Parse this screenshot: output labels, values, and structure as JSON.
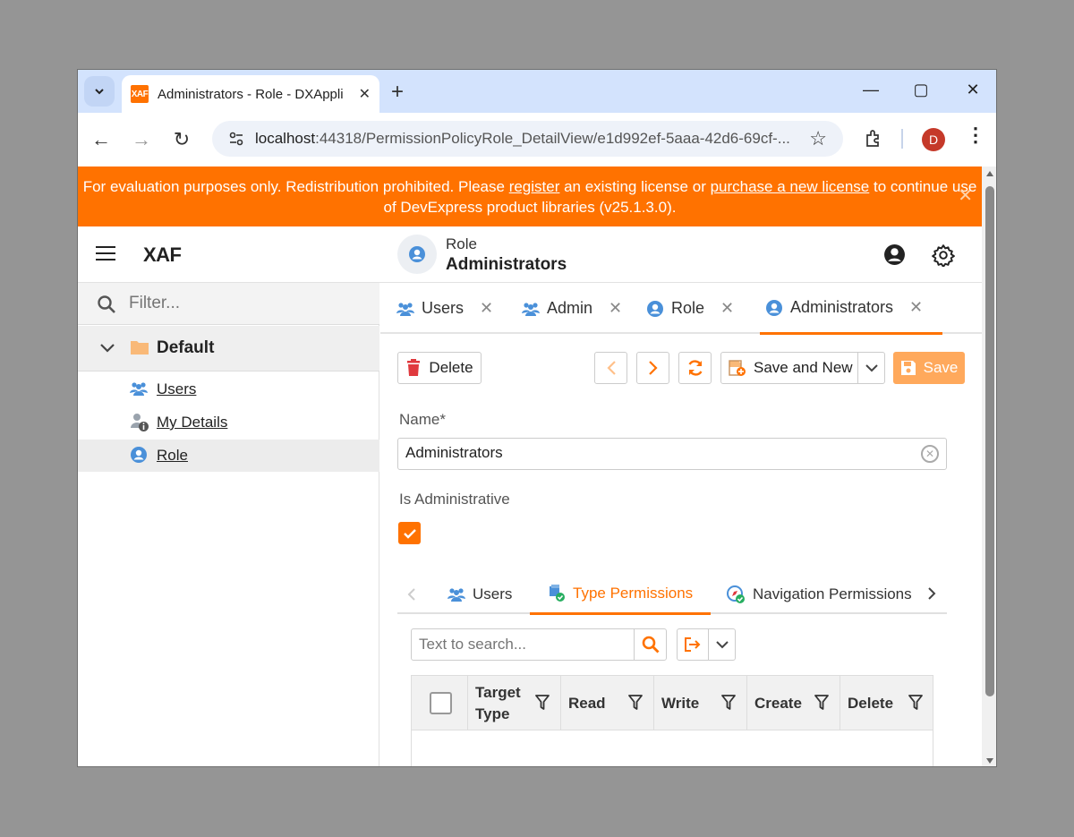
{
  "browser": {
    "tab_title": "Administrators - Role - DXAppli",
    "favicon_text": "XAF",
    "url_host": "localhost",
    "url_path": ":44318/PermissionPolicyRole_DetailView/e1d992ef-5aaa-42d6-69cf-...",
    "profile_initial": "D"
  },
  "banner": {
    "text_before": "For evaluation purposes only. Redistribution prohibited. Please ",
    "link_register": "register",
    "text_middle": " an existing license or ",
    "link_purchase": "purchase a new license",
    "text_after": " to continue use of DevExpress product libraries (v25.1.3.0)."
  },
  "header": {
    "app_title": "XAF",
    "view_caption": "Role",
    "object_title": "Administrators"
  },
  "sidebar": {
    "filter_placeholder": "Filter...",
    "group_label": "Default",
    "items": [
      {
        "label": "Users"
      },
      {
        "label": "My Details"
      },
      {
        "label": "Role"
      }
    ]
  },
  "doc_tabs": [
    {
      "label": "Users"
    },
    {
      "label": "Admin"
    },
    {
      "label": "Role"
    },
    {
      "label": "Administrators"
    }
  ],
  "toolbar": {
    "delete_label": "Delete",
    "save_and_new_label": "Save and New",
    "save_label": "Save"
  },
  "form": {
    "name_label": "Name*",
    "name_value": "Administrators",
    "is_admin_label": "Is Administrative",
    "is_admin_checked": true
  },
  "sub_tabs": [
    {
      "label": "Users"
    },
    {
      "label": "Type Permissions"
    },
    {
      "label": "Navigation Permissions"
    }
  ],
  "grid": {
    "search_placeholder": "Text to search...",
    "columns": [
      "Target Type",
      "Read",
      "Write",
      "Create",
      "Delete"
    ]
  },
  "colors": {
    "accent": "#ff7200",
    "save_disabled": "#ffa95c",
    "icon_blue": "#4a90d9"
  }
}
